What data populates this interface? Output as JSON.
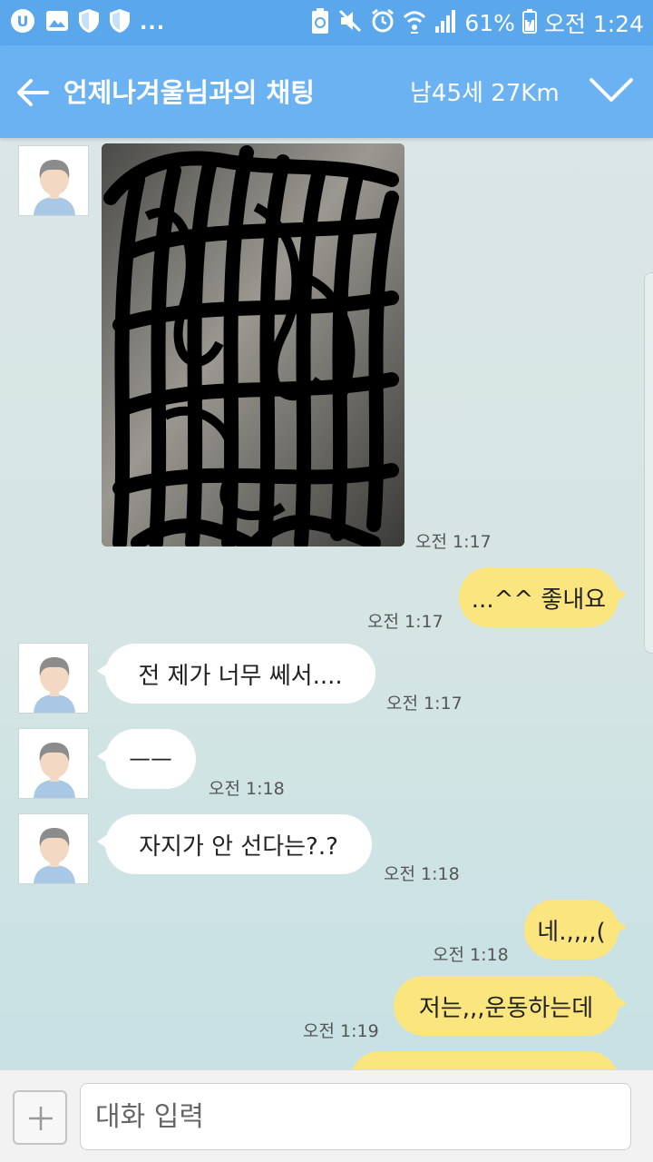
{
  "status_bar": {
    "battery": "61%",
    "time": "오전 1:24",
    "more": "...",
    "icons": [
      "u-plus-icon",
      "image-icon",
      "shield-icon",
      "shield-icon",
      "recycle-battery-icon",
      "mute-icon",
      "alarm-icon",
      "wifi-icon",
      "signal-icon",
      "battery-icon"
    ]
  },
  "header": {
    "title": "언제나겨울님과의 채팅",
    "subtitle": "남45세 27Km",
    "back_icon": "back-arrow-icon",
    "expand_icon": "chevron-down-icon"
  },
  "messages": [
    {
      "side": "in",
      "kind": "image",
      "note": "censored",
      "time": "오전 1:17"
    },
    {
      "side": "out",
      "text": "...^^ 좋내요",
      "time": "오전 1:17"
    },
    {
      "side": "in",
      "text": "전 제가 너무 쎄서....",
      "time": "오전 1:17"
    },
    {
      "side": "in",
      "text": "ㅡㅡ",
      "time": "오전 1:18"
    },
    {
      "side": "in",
      "text": "자지가 안 선다는?.?",
      "time": "오전 1:18"
    },
    {
      "side": "out",
      "text": "네.,,,,(",
      "time": "오전 1:18"
    },
    {
      "side": "out",
      "text": "저는,,,운동하는데",
      "time": "오전 1:19"
    }
  ],
  "input": {
    "placeholder": "대화 입력",
    "value": ""
  },
  "colors": {
    "status_bar": "#5aa7ec",
    "title_bar": "#6ab2f1",
    "bubble_in": "#ffffff",
    "bubble_out": "#fbe57f",
    "chat_bg": "#d5e5e3"
  }
}
